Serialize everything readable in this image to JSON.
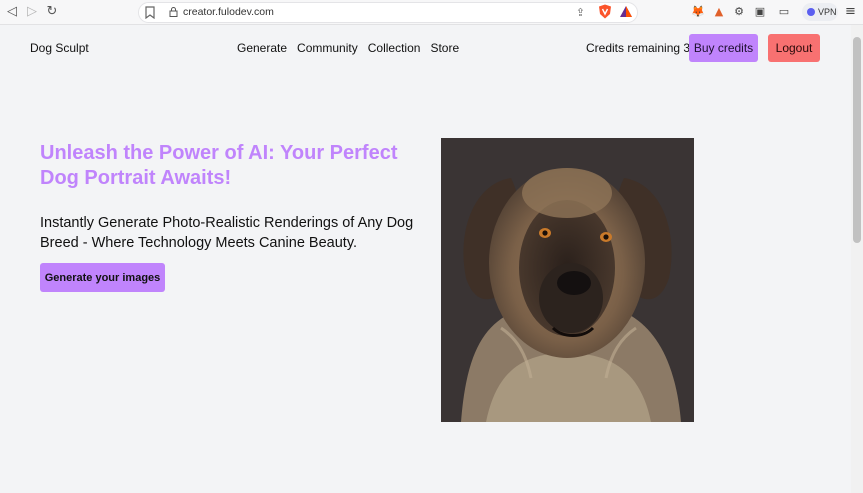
{
  "browser": {
    "url": "creator.fulodev.com",
    "vpn_label": "VPN"
  },
  "header": {
    "brand": "Dog Sculpt",
    "nav": [
      "Generate",
      "Community",
      "Collection",
      "Store"
    ],
    "credits_text": "Credits remaining 30",
    "buy_credits": "Buy credits",
    "logout": "Logout"
  },
  "hero": {
    "title": "Unleash the Power of AI: Your Perfect Dog Portrait Awaits!",
    "subtitle": "Instantly Generate Photo-Realistic Renderings of Any Dog Breed - Where Technology Meets Canine Beauty.",
    "cta": "Generate your images"
  },
  "colors": {
    "accent": "#c084fc",
    "danger": "#f87171",
    "background": "#f3f4f6"
  }
}
